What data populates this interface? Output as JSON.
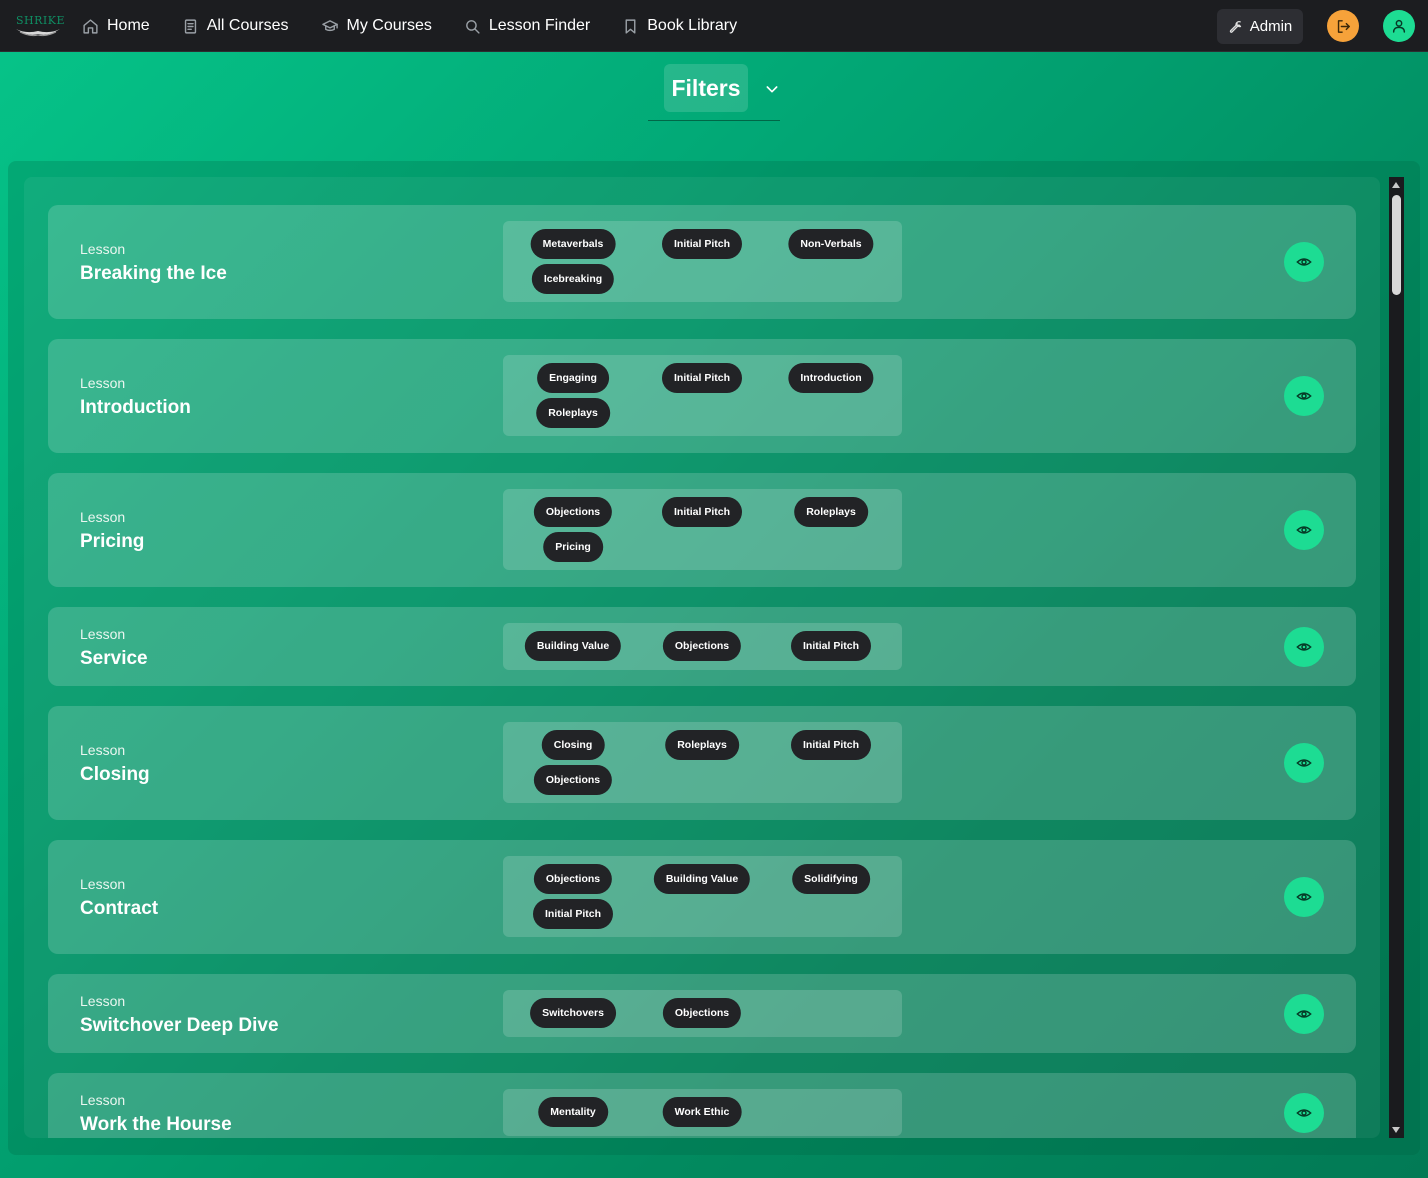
{
  "nav": {
    "logo_text": "SHRIKE",
    "items": [
      {
        "label": "Home",
        "icon": "home-icon"
      },
      {
        "label": "All Courses",
        "icon": "document-icon"
      },
      {
        "label": "My Courses",
        "icon": "graduation-cap-icon"
      },
      {
        "label": "Lesson Finder",
        "icon": "search-icon"
      },
      {
        "label": "Book Library",
        "icon": "bookmark-icon"
      }
    ],
    "admin_label": "Admin"
  },
  "filters": {
    "label": "Filters"
  },
  "lessons": [
    {
      "type": "Lesson",
      "title": "Breaking the Ice",
      "tags": [
        "Metaverbals",
        "Initial Pitch",
        "Non-Verbals",
        "Icebreaking"
      ]
    },
    {
      "type": "Lesson",
      "title": "Introduction",
      "tags": [
        "Engaging",
        "Initial Pitch",
        "Introduction",
        "Roleplays"
      ]
    },
    {
      "type": "Lesson",
      "title": "Pricing",
      "tags": [
        "Objections",
        "Initial Pitch",
        "Roleplays",
        "Pricing"
      ]
    },
    {
      "type": "Lesson",
      "title": "Service",
      "tags": [
        "Building Value",
        "Objections",
        "Initial Pitch"
      ]
    },
    {
      "type": "Lesson",
      "title": "Closing",
      "tags": [
        "Closing",
        "Roleplays",
        "Initial Pitch",
        "Objections"
      ]
    },
    {
      "type": "Lesson",
      "title": "Contract",
      "tags": [
        "Objections",
        "Building Value",
        "Solidifying",
        "Initial Pitch"
      ]
    },
    {
      "type": "Lesson",
      "title": "Switchover Deep Dive",
      "tags": [
        "Switchovers",
        "Objections"
      ]
    },
    {
      "type": "Lesson",
      "title": "Work the Hourse",
      "tags": [
        "Mentality",
        "Work Ethic"
      ]
    }
  ],
  "colors": {
    "accent": "#1ddc93",
    "logout": "#f6a23a",
    "navbar": "#1c1d20",
    "tag": "#222326"
  }
}
